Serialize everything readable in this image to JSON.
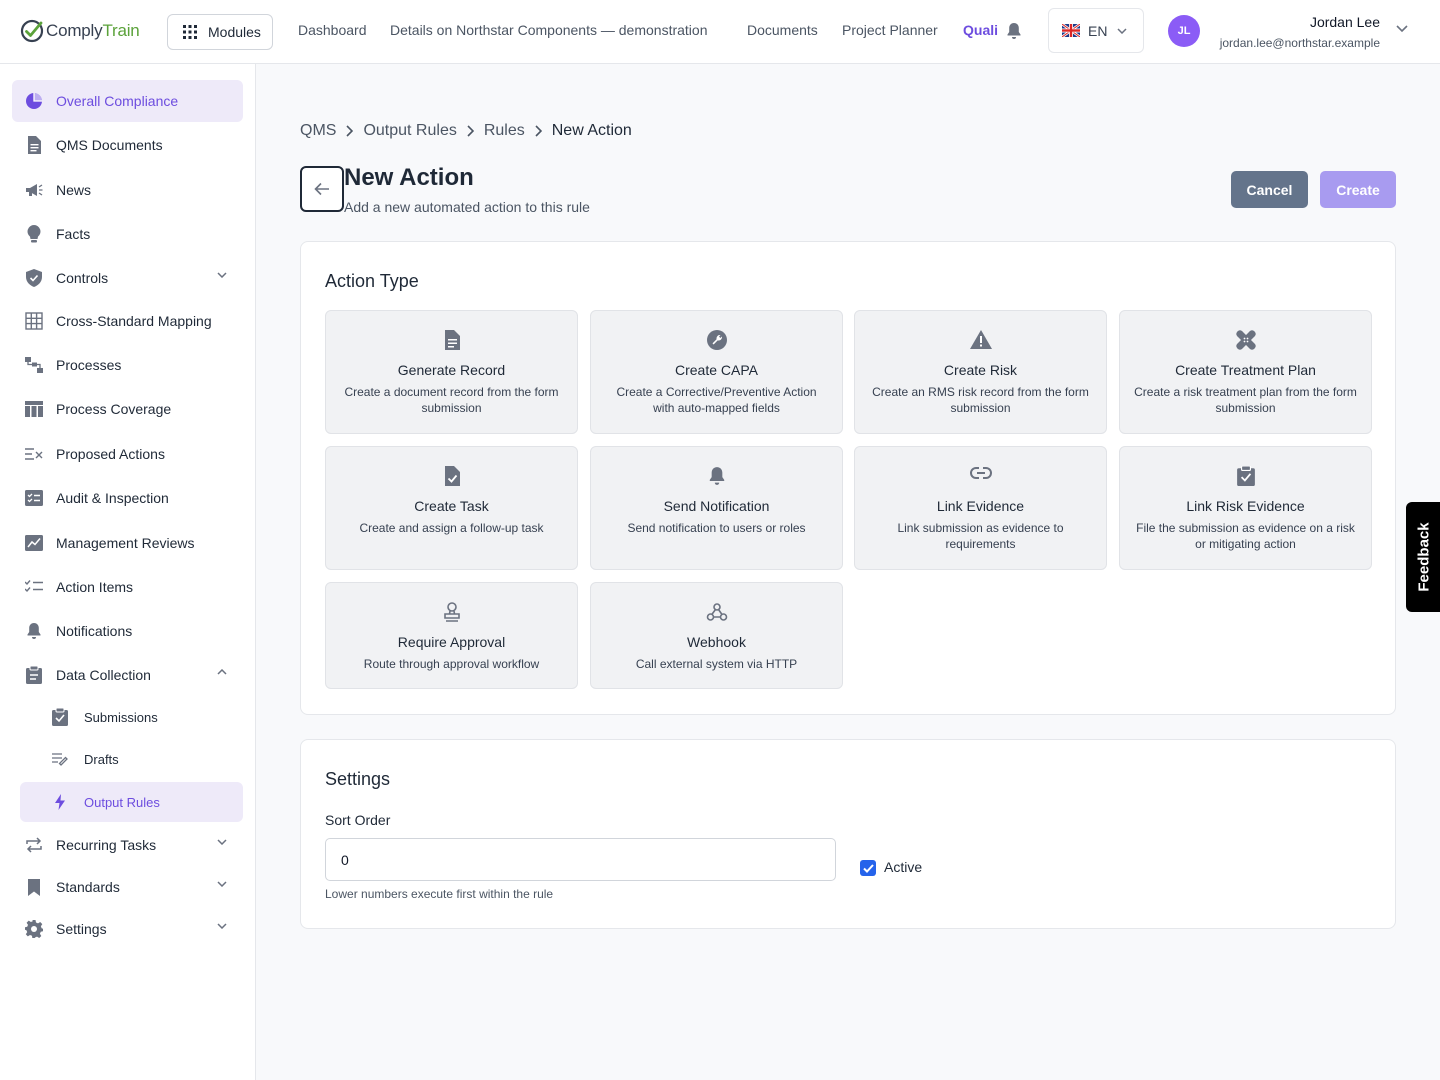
{
  "app": {
    "logo_part1": "Comply",
    "logo_part2": "Train",
    "modules_label": "Modules"
  },
  "topnav": {
    "items": [
      {
        "label": "Dashboard"
      },
      {
        "label": "Details on Northstar Components — demonstration"
      },
      {
        "label": "Documents"
      },
      {
        "label": "Project Planner"
      },
      {
        "label": "Quali",
        "active": true
      }
    ],
    "language": "EN",
    "language_flag": "uk-flag-icon"
  },
  "user": {
    "initials": "JL",
    "name": "Jordan Lee",
    "email": "jordan.lee@northstar.example",
    "avatar_color": "#8b5cf6"
  },
  "sidebar": {
    "items": [
      {
        "label": "Overall Compliance",
        "icon": "pie-chart-icon",
        "active": true
      },
      {
        "label": "QMS Documents",
        "icon": "document-icon"
      },
      {
        "label": "News",
        "icon": "megaphone-icon"
      },
      {
        "label": "Facts",
        "icon": "lightbulb-icon"
      },
      {
        "label": "Controls",
        "icon": "shield-icon",
        "expandable": true
      },
      {
        "label": "Cross-Standard Mapping",
        "icon": "grid-icon"
      },
      {
        "label": "Processes",
        "icon": "flow-icon"
      },
      {
        "label": "Process Coverage",
        "icon": "table-icon"
      },
      {
        "label": "Proposed Actions",
        "icon": "list-x-icon"
      },
      {
        "label": "Audit & Inspection",
        "icon": "checklist-box-icon"
      },
      {
        "label": "Management Reviews",
        "icon": "chart-box-icon"
      },
      {
        "label": "Action Items",
        "icon": "list-check-icon"
      },
      {
        "label": "Notifications",
        "icon": "bell-icon"
      },
      {
        "label": "Data Collection",
        "icon": "clipboard-icon",
        "expanded": true
      },
      {
        "label": "Recurring Tasks",
        "icon": "repeat-icon",
        "expandable": true
      },
      {
        "label": "Standards",
        "icon": "bookmark-icon",
        "expandable": true
      },
      {
        "label": "Settings",
        "icon": "gear-icon",
        "expandable": true
      }
    ],
    "subitems": [
      {
        "label": "Submissions",
        "icon": "clipboard-check-icon"
      },
      {
        "label": "Drafts",
        "icon": "list-pen-icon"
      },
      {
        "label": "Output Rules",
        "icon": "bolt-icon",
        "active": true
      }
    ]
  },
  "breadcrumb": [
    "QMS",
    "Output Rules",
    "Rules",
    "New Action"
  ],
  "page": {
    "title": "New Action",
    "subtitle": "Add a new automated action to this rule",
    "cancel_label": "Cancel",
    "create_label": "Create"
  },
  "action_type": {
    "title": "Action Type",
    "tiles": [
      {
        "title": "Generate Record",
        "desc": "Create a document record from the form submission",
        "icon": "document-icon"
      },
      {
        "title": "Create CAPA",
        "desc": "Create a Corrective/Preventive Action with auto-mapped fields",
        "icon": "wrench-icon"
      },
      {
        "title": "Create Risk",
        "desc": "Create an RMS risk record from the form submission",
        "icon": "warning-icon"
      },
      {
        "title": "Create Treatment Plan",
        "desc": "Create a risk treatment plan from the form submission",
        "icon": "bandage-icon"
      },
      {
        "title": "Create Task",
        "desc": "Create and assign a follow-up task",
        "icon": "document-check-icon"
      },
      {
        "title": "Send Notification",
        "desc": "Send notification to users or roles",
        "icon": "bell-icon"
      },
      {
        "title": "Link Evidence",
        "desc": "Link submission as evidence to requirements",
        "icon": "link-icon"
      },
      {
        "title": "Link Risk Evidence",
        "desc": "File the submission as evidence on a risk or mitigating action",
        "icon": "clipboard-check-icon"
      },
      {
        "title": "Require Approval",
        "desc": "Route through approval workflow",
        "icon": "stamp-icon"
      },
      {
        "title": "Webhook",
        "desc": "Call external system via HTTP",
        "icon": "webhook-icon"
      }
    ]
  },
  "settings": {
    "title": "Settings",
    "sort_order_label": "Sort Order",
    "sort_order_value": "0",
    "sort_order_help": "Lower numbers execute first within the rule",
    "active_label": "Active",
    "active_checked": true
  },
  "feedback_label": "Feedback",
  "colors": {
    "accent": "#6d4ddf",
    "accent_bg": "#eeeaf9",
    "cancel_bg": "#64748b",
    "create_bg": "#a89bf0",
    "logo_green": "#5ba23a",
    "checkbox": "#2563eb"
  }
}
